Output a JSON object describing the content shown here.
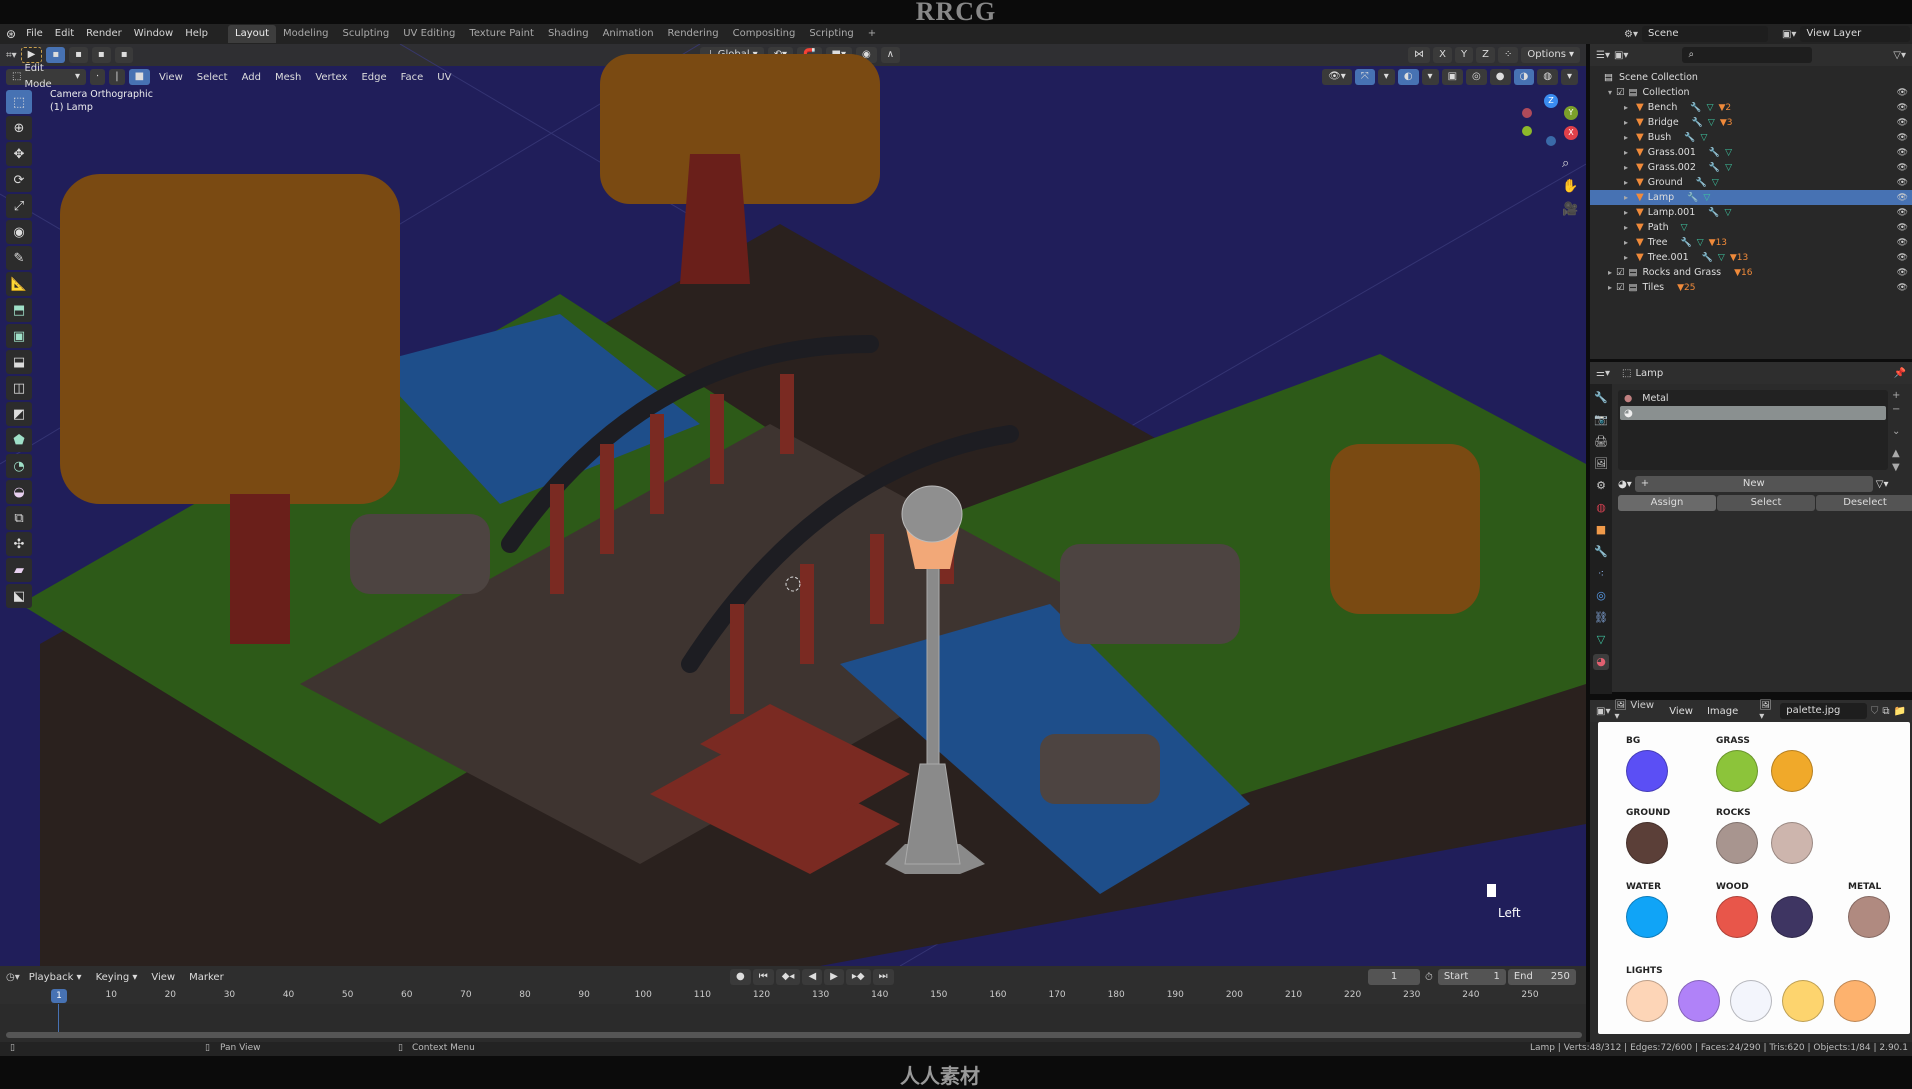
{
  "watermark_top": "RRCG",
  "watermark_bottom": "人人素材",
  "menubar": {
    "menus": [
      "File",
      "Edit",
      "Render",
      "Window",
      "Help"
    ],
    "workspaces": [
      "Layout",
      "Modeling",
      "Sculpting",
      "UV Editing",
      "Texture Paint",
      "Shading",
      "Animation",
      "Rendering",
      "Compositing",
      "Scripting"
    ],
    "active_workspace": "Layout",
    "add_tab": "+",
    "scene_label": "Scene",
    "view_layer_label": "View Layer"
  },
  "tool_header": {
    "transform_orientation": "Global",
    "axis_labels": [
      "X",
      "Y",
      "Z"
    ],
    "options_label": "Options"
  },
  "viewport_header": {
    "mode": "Edit Mode",
    "menus": [
      "View",
      "Select",
      "Add",
      "Mesh",
      "Vertex",
      "Edge",
      "Face",
      "UV"
    ]
  },
  "viewport": {
    "view_name": "Camera Orthographic",
    "object_info": "(1) Lamp",
    "camera_marker_label": "Left",
    "gizmo_axes": [
      "X",
      "Y",
      "Z"
    ]
  },
  "toolbar_icons": [
    "select-box",
    "cursor",
    "move",
    "rotate",
    "scale",
    "transform",
    "annotate",
    "measure",
    "extrude",
    "inset",
    "bevel",
    "loop-cut",
    "knife",
    "poly-build",
    "spin",
    "smooth",
    "edge-slide",
    "shrink-fatten",
    "shear",
    "rip-region"
  ],
  "outliner": {
    "root": "Scene Collection",
    "items": [
      {
        "name": "Collection",
        "type": "collection",
        "expanded": true,
        "level": 1
      },
      {
        "name": "Bench",
        "type": "mesh",
        "level": 2,
        "badge": "2"
      },
      {
        "name": "Bridge",
        "type": "mesh",
        "level": 2,
        "badge": "3"
      },
      {
        "name": "Bush",
        "type": "mesh",
        "level": 2,
        "badge": ""
      },
      {
        "name": "Grass.001",
        "type": "mesh",
        "level": 2,
        "badge": ""
      },
      {
        "name": "Grass.002",
        "type": "mesh",
        "level": 2,
        "badge": ""
      },
      {
        "name": "Ground",
        "type": "mesh",
        "level": 2,
        "badge": ""
      },
      {
        "name": "Lamp",
        "type": "mesh",
        "level": 2,
        "badge": "",
        "selected": true
      },
      {
        "name": "Lamp.001",
        "type": "mesh",
        "level": 2,
        "badge": ""
      },
      {
        "name": "Path",
        "type": "mesh",
        "level": 2,
        "badge": ""
      },
      {
        "name": "Tree",
        "type": "mesh",
        "level": 2,
        "badge": "13"
      },
      {
        "name": "Tree.001",
        "type": "mesh",
        "level": 2,
        "badge": "13"
      },
      {
        "name": "Rocks and Grass",
        "type": "collection",
        "level": 1,
        "badge": "16"
      },
      {
        "name": "Tiles",
        "type": "collection",
        "level": 1,
        "badge": "25"
      }
    ]
  },
  "properties": {
    "object_name": "Lamp",
    "material_slots": [
      "Metal",
      ""
    ],
    "new_button": "New",
    "assign_button": "Assign",
    "select_button": "Select",
    "deselect_button": "Deselect"
  },
  "image_editor": {
    "menus": [
      "View",
      "View",
      "Image"
    ],
    "image_name": "palette.jpg",
    "palette": [
      {
        "label": "BG",
        "colors": [
          "#5b4ff5"
        ]
      },
      {
        "label": "GRASS",
        "colors": [
          "#8cc43a",
          "#f0a92a"
        ]
      },
      {
        "label": "GROUND",
        "colors": [
          "#5b3f38"
        ]
      },
      {
        "label": "ROCKS",
        "colors": [
          "#a8958f",
          "#cdb5ad"
        ]
      },
      {
        "label": "WATER",
        "colors": [
          "#10a4f7"
        ]
      },
      {
        "label": "WOOD",
        "colors": [
          "#e8564a",
          "#3e3562"
        ]
      },
      {
        "label": "METAL",
        "colors": [
          "#b08a80"
        ]
      },
      {
        "label": "LIGHTS",
        "colors": [
          "#fdd5b7",
          "#b082f8",
          "#f3f5fc",
          "#fdd46e",
          "#fdb26e"
        ]
      }
    ]
  },
  "timeline": {
    "menus": [
      "Playback",
      "Keying",
      "View",
      "Marker"
    ],
    "current_frame": "1",
    "start_label": "Start",
    "start": "1",
    "end_label": "End",
    "end": "250",
    "ticks": [
      "10",
      "20",
      "30",
      "40",
      "50",
      "60",
      "70",
      "80",
      "90",
      "100",
      "110",
      "120",
      "130",
      "140",
      "150",
      "160",
      "170",
      "180",
      "190",
      "200",
      "210",
      "220",
      "230",
      "240",
      "250"
    ]
  },
  "statusbar": {
    "left_hint": "",
    "pan_hint": "Pan View",
    "context_hint": "Context Menu",
    "stats": "Lamp | Verts:48/312 | Edges:72/600 | Faces:24/290 | Tris:620 | Objects:1/84 | 2.90.1"
  }
}
